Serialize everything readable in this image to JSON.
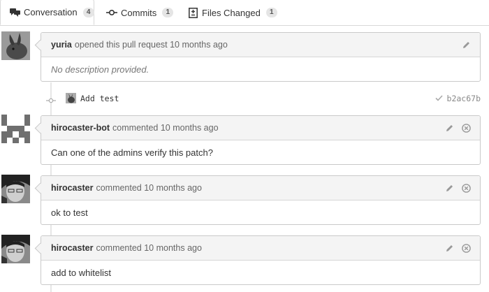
{
  "tabs": [
    {
      "label": "Conversation",
      "count": "4",
      "icon": "comments-icon"
    },
    {
      "label": "Commits",
      "count": "1",
      "icon": "commit-icon"
    },
    {
      "label": "Files Changed",
      "count": "1",
      "icon": "file-diff-icon"
    }
  ],
  "opening": {
    "author": "yuria",
    "action": "opened this pull request 10 months ago",
    "body": "No description provided."
  },
  "commit": {
    "message": "Add test",
    "sha": "b2ac67b",
    "status_icon": "check-icon"
  },
  "comments": [
    {
      "author": "hirocaster-bot",
      "action": "commented 10 months ago",
      "body": "Can one of the admins verify this patch?"
    },
    {
      "author": "hirocaster",
      "action": "commented 10 months ago",
      "body": "ok to test"
    },
    {
      "author": "hirocaster",
      "action": "commented 10 months ago",
      "body": "add to whitelist"
    }
  ],
  "colors": {
    "header_bg": "#f4f4f4",
    "border": "#c9c9c9",
    "badge_bg": "#e5e5e5",
    "muted_text": "#777777"
  }
}
